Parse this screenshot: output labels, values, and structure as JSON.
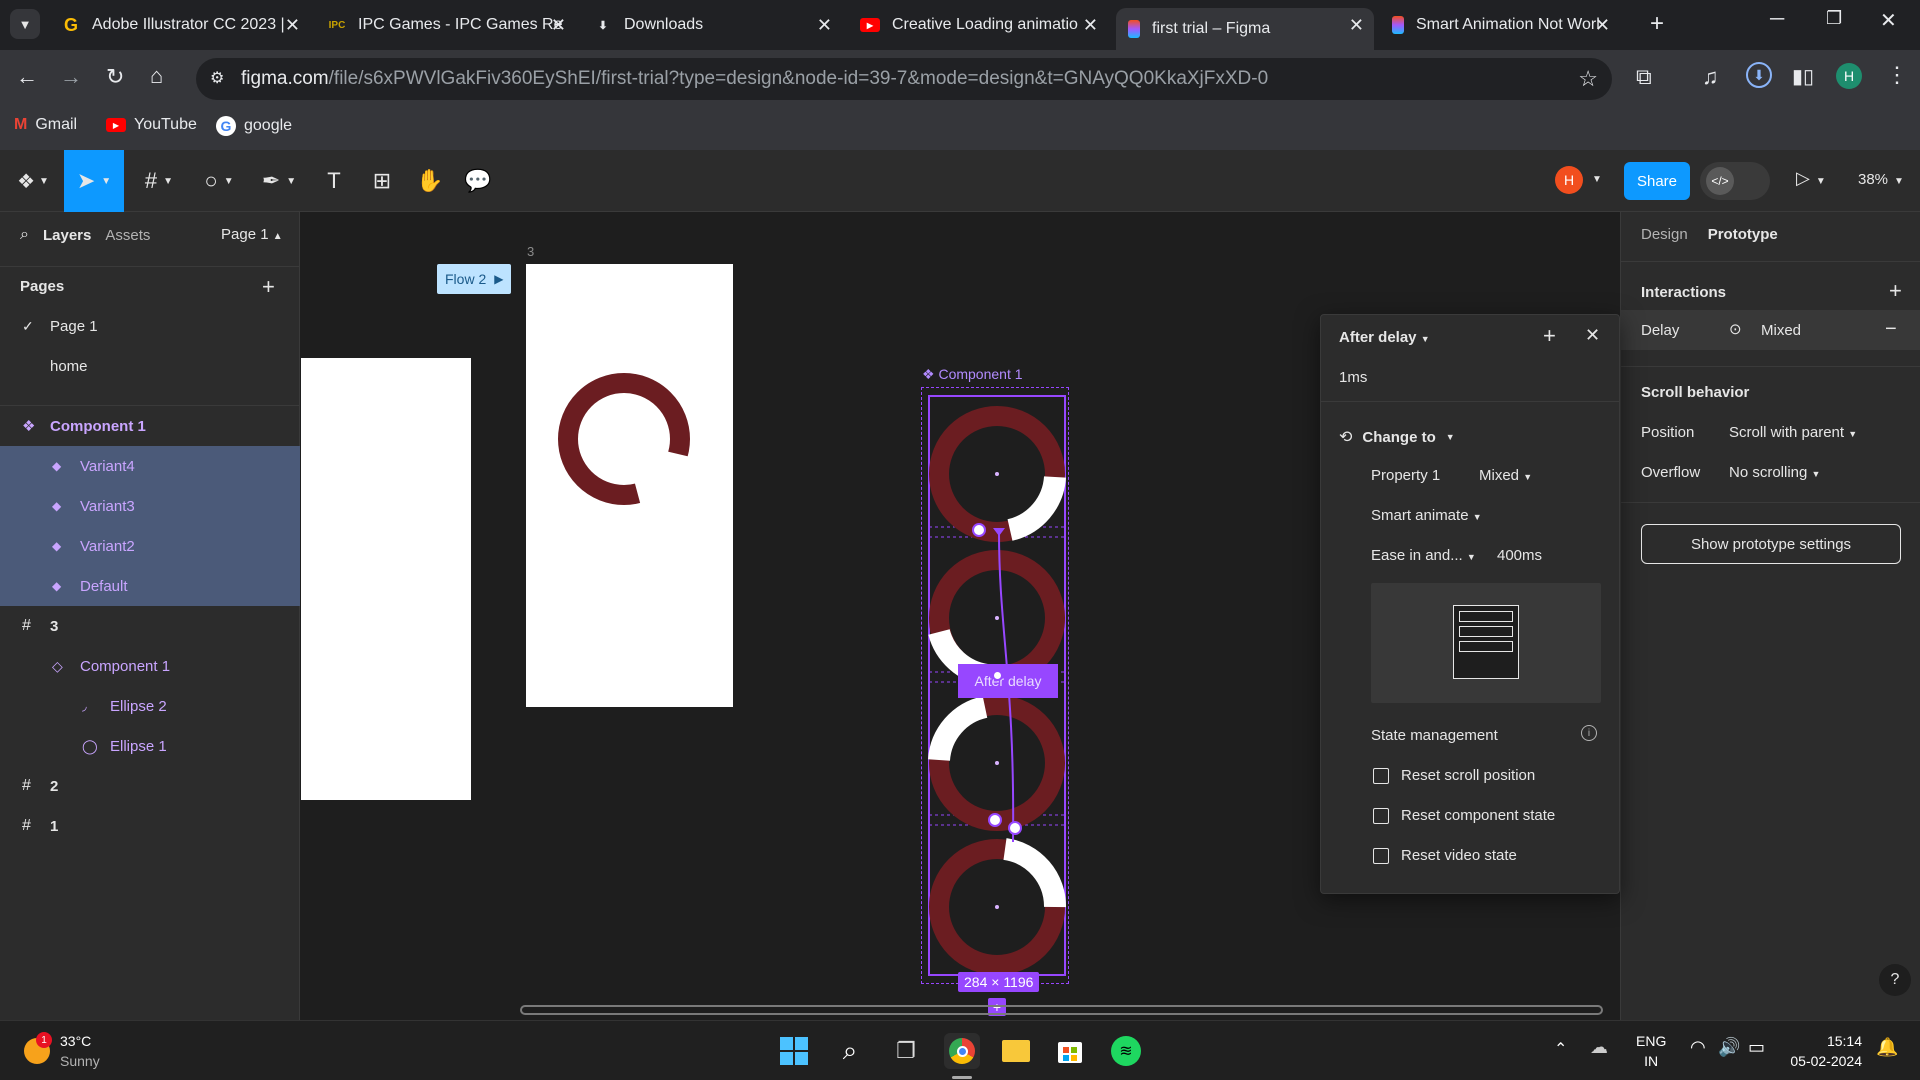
{
  "browser": {
    "tabs": [
      {
        "title": "Adobe Illustrator CC 2023 |",
        "favicon": "G"
      },
      {
        "title": "IPC Games - IPC Games Re",
        "favicon": "IPC"
      },
      {
        "title": "Downloads",
        "favicon": "download-icon"
      },
      {
        "title": "Creative Loading animatio",
        "favicon": "youtube-icon"
      },
      {
        "title": "first trial – Figma",
        "favicon": "figma-icon"
      },
      {
        "title": "Smart Animation Not Worl",
        "favicon": "figma-icon"
      }
    ],
    "url_host": "figma.com",
    "url_path": "/file/s6xPWVlGakFiv360EyShEI/first-trial?type=design&node-id=39-7&mode=design&t=GNAyQQ0KkaXjFxXD-0",
    "profile_initial": "H",
    "bookmarks": [
      "Gmail",
      "YouTube",
      "google"
    ]
  },
  "figma": {
    "share_label": "Share",
    "zoom": "38%",
    "avatar_initial": "H",
    "left": {
      "tab_layers": "Layers",
      "tab_assets": "Assets",
      "page_select": "Page 1",
      "pages_title": "Pages",
      "pages": [
        "Page 1",
        "home"
      ],
      "layers": [
        {
          "label": "Component 1"
        },
        {
          "label": "Variant4"
        },
        {
          "label": "Variant3"
        },
        {
          "label": "Variant2"
        },
        {
          "label": "Default"
        },
        {
          "label": "3"
        },
        {
          "label": "Component 1"
        },
        {
          "label": "Ellipse 2"
        },
        {
          "label": "Ellipse 1"
        },
        {
          "label": "2"
        },
        {
          "label": "1"
        }
      ]
    },
    "canvas": {
      "frame_label": "3",
      "flow_label": "Flow 2",
      "component_label": "Component 1",
      "connector_label": "After delay",
      "size_label": "284 × 1196"
    },
    "right": {
      "tab_design": "Design",
      "tab_prototype": "Prototype",
      "interactions_title": "Interactions",
      "delay_label": "Delay",
      "delay_value": "Mixed",
      "scroll_title": "Scroll behavior",
      "position_label": "Position",
      "position_value": "Scroll with parent",
      "overflow_label": "Overflow",
      "overflow_value": "No scrolling",
      "settings_button": "Show prototype settings"
    },
    "popup": {
      "trigger": "After delay",
      "delay": "1ms",
      "action": "Change to",
      "property_label": "Property 1",
      "property_value": "Mixed",
      "animation": "Smart animate",
      "easing": "Ease in and...",
      "duration": "400ms",
      "state_title": "State management",
      "options": [
        "Reset scroll position",
        "Reset component state",
        "Reset video state"
      ]
    }
  },
  "taskbar": {
    "weather_temp": "33°C",
    "weather_desc": "Sunny",
    "weather_badge": "1",
    "lang_top": "ENG",
    "lang_bottom": "IN",
    "time": "15:14",
    "date": "05-02-2024"
  },
  "colors": {
    "figma_blue": "#0d99ff",
    "purple": "#9747ff",
    "ring": "#6b1d21",
    "selection": "#4b5a79"
  }
}
